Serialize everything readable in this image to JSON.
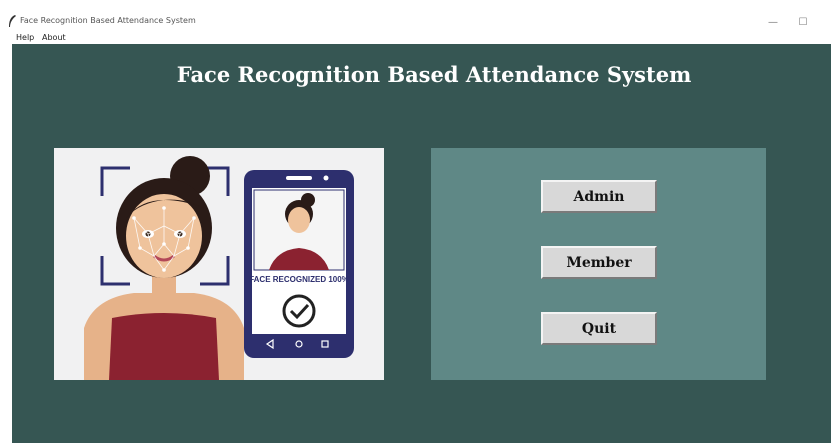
{
  "window": {
    "title": "Face Recognition Based Attendance System",
    "minimize_glyph": "—",
    "maximize_glyph": "☐"
  },
  "menu": {
    "items": [
      "Help",
      "About"
    ]
  },
  "main": {
    "heading": "Face Recognition Based Attendance System",
    "illustration": {
      "phone_caption": "FACE RECOGNIZED 100%"
    },
    "buttons": {
      "admin": "Admin",
      "member": "Member",
      "quit": "Quit"
    }
  },
  "colors": {
    "background": "#365653",
    "panel": "#5f8886",
    "button": "#d8d8d8",
    "illustration_bg": "#f1f1f2",
    "phone": "#2d2f6e"
  },
  "icons": [
    "feather-icon",
    "minimize-icon",
    "maximize-icon",
    "checkmark-icon"
  ]
}
